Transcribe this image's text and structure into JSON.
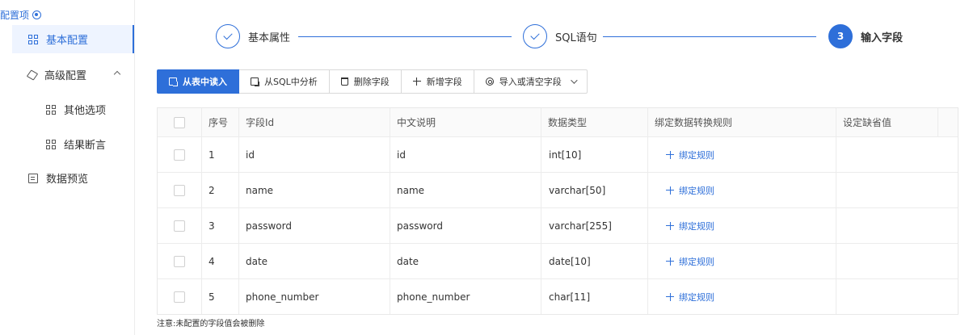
{
  "sidebar": {
    "title": "配置项",
    "items": [
      {
        "label": "基本配置",
        "active": true
      },
      {
        "label": "高级配置",
        "expandable": true
      },
      {
        "label": "其他选项"
      },
      {
        "label": "结果断言"
      },
      {
        "label": "数据预览"
      }
    ]
  },
  "steps": [
    {
      "label": "基本属性",
      "status": "done"
    },
    {
      "label": "SQL语句",
      "status": "done"
    },
    {
      "number": "3",
      "label": "输入字段",
      "status": "current"
    }
  ],
  "toolbar": {
    "read_from_table": "从表中读入",
    "analyze_sql": "从SQL中分析",
    "delete_field": "删除字段",
    "add_field": "新增字段",
    "import_clear": "导入或清空字段"
  },
  "table": {
    "columns": [
      "序号",
      "字段Id",
      "中文说明",
      "数据类型",
      "绑定数据转换规则",
      "设定缺省值"
    ],
    "rows": [
      {
        "index": "1",
        "field_id": "id",
        "description": "id",
        "type": "int[10]",
        "rule": "绑定规则"
      },
      {
        "index": "2",
        "field_id": "name",
        "description": "name",
        "type": "varchar[50]",
        "rule": "绑定规则"
      },
      {
        "index": "3",
        "field_id": "password",
        "description": "password",
        "type": "varchar[255]",
        "rule": "绑定规则"
      },
      {
        "index": "4",
        "field_id": "date",
        "description": "date",
        "type": "date[10]",
        "rule": "绑定规则"
      },
      {
        "index": "5",
        "field_id": "phone_number",
        "description": "phone_number",
        "type": "char[11]",
        "rule": "绑定规则"
      }
    ]
  },
  "note": "注意:未配置的字段值会被删除",
  "colors": {
    "accent": "#2e6fd9",
    "active_bg": "#eef4ff"
  }
}
